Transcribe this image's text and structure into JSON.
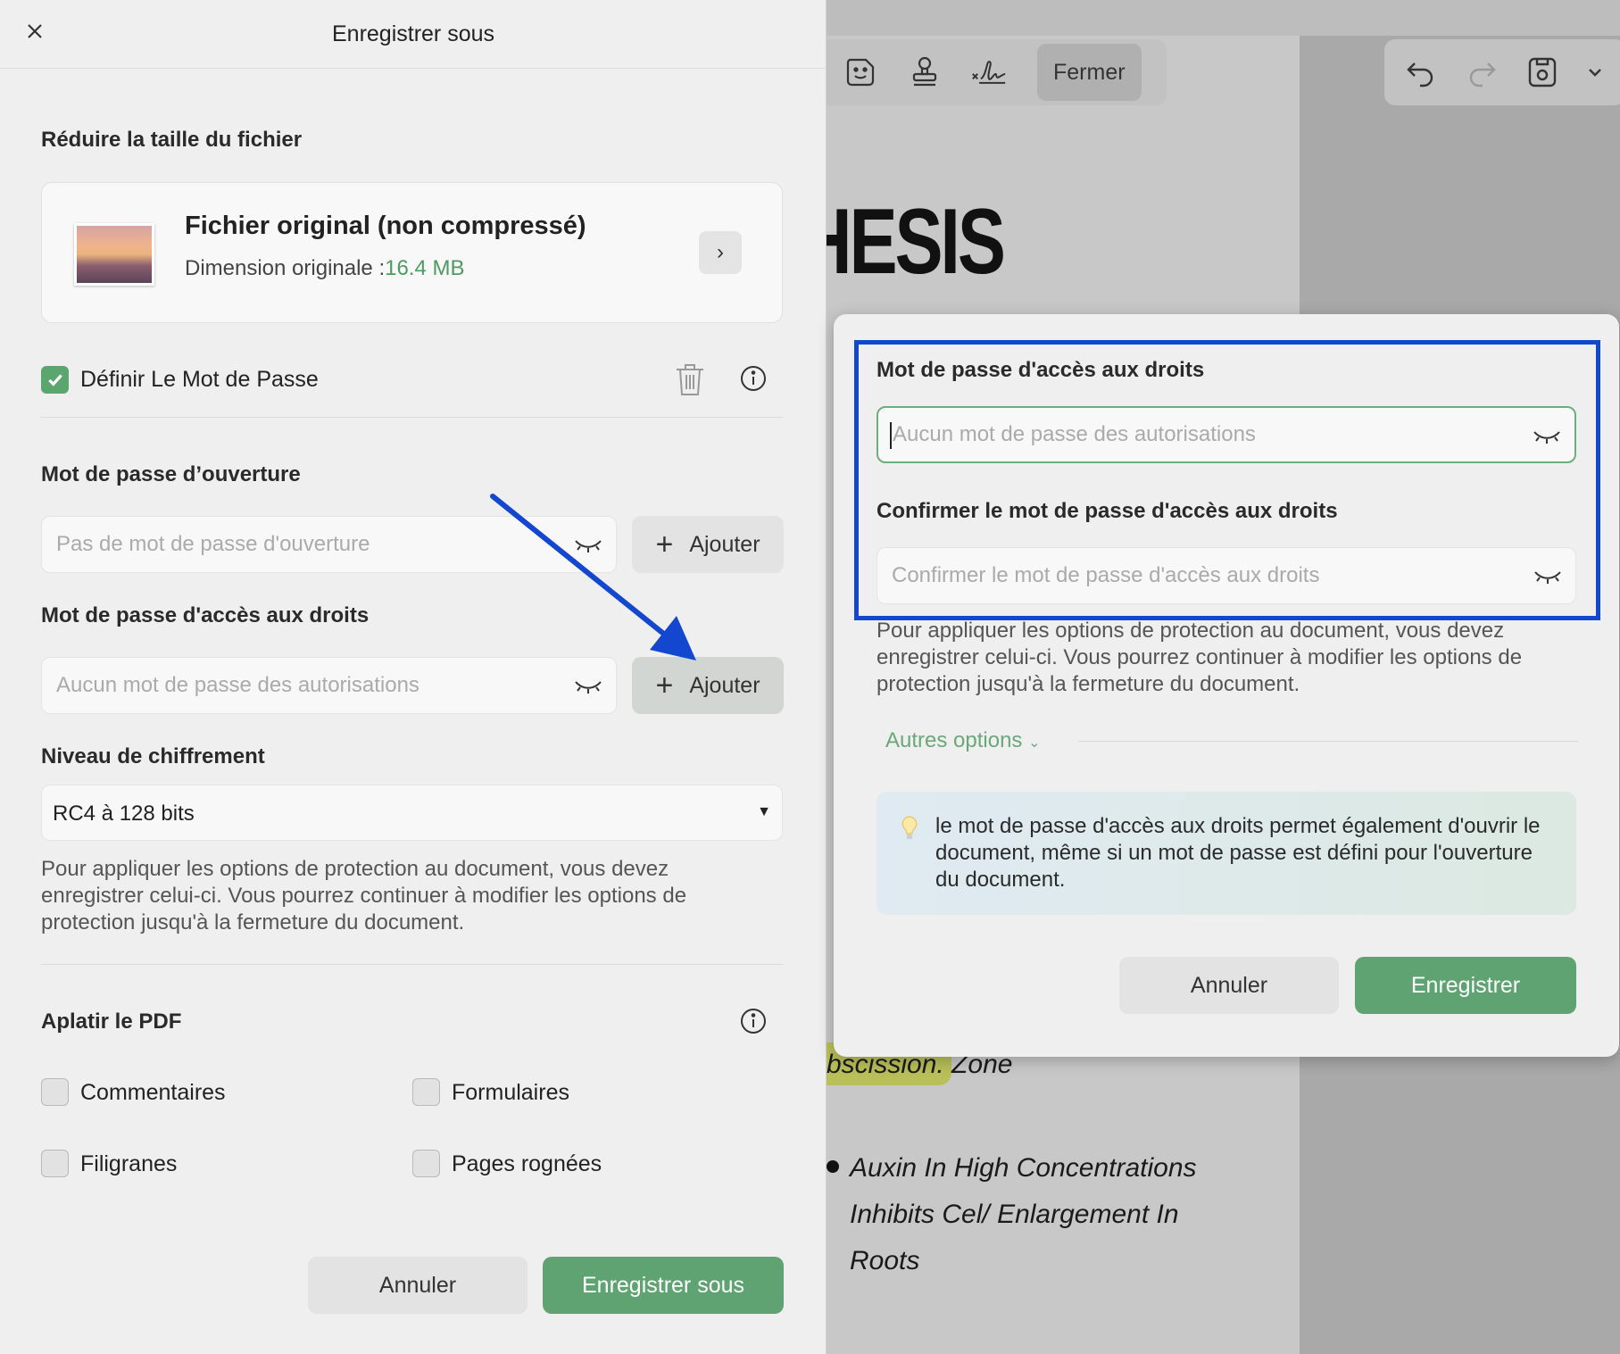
{
  "background": {
    "toolbar": {
      "close_label": "Fermer"
    },
    "document": {
      "heading": "HESIS",
      "highlight_text": "bscission. Zone",
      "lines": [
        "Auxin In High Concentrations",
        "Inhibits Cel/ Enlargement In",
        "Roots"
      ]
    }
  },
  "save_dialog": {
    "title": "Enregistrer sous",
    "reduce_section_title": "Réduire la taille du fichier",
    "file_card": {
      "name": "Fichier original (non compressé)",
      "size_label": "Dimension originale :",
      "size_value": "16.4 MB"
    },
    "set_password": {
      "label": "Définir Le Mot de Passe",
      "checked": true
    },
    "open_password": {
      "title": "Mot de passe d’ouverture",
      "placeholder": "Pas de mot de passe d'ouverture",
      "add_label": "Ajouter"
    },
    "permissions_password": {
      "title": "Mot de passe d'accès aux droits",
      "placeholder": "Aucun mot de passe des autorisations",
      "add_label": "Ajouter"
    },
    "encryption": {
      "title": "Niveau de chiffrement",
      "value": "RC4 à 128 bits"
    },
    "note": "Pour appliquer les options de protection au document, vous devez enregistrer celui-ci. Vous pourrez continuer à modifier les options de protection jusqu'à la fermeture du document.",
    "flatten": {
      "title": "Aplatir le PDF",
      "options": [
        {
          "label": "Commentaires",
          "checked": false
        },
        {
          "label": "Formulaires",
          "checked": false
        },
        {
          "label": "Filigranes",
          "checked": false
        },
        {
          "label": "Pages rognées",
          "checked": false
        }
      ]
    },
    "cancel_label": "Annuler",
    "save_label": "Enregistrer sous"
  },
  "permissions_dialog": {
    "title": "Mot de passe d'accès aux droits",
    "placeholder": "Aucun mot de passe des autorisations",
    "confirm_title": "Confirmer le mot de passe d'accès aux droits",
    "confirm_placeholder": "Confirmer le mot de passe d'accès aux droits",
    "note": "Pour appliquer les options de protection au document, vous devez enregistrer celui-ci. Vous pourrez continuer à modifier les options de protection jusqu'à la fermeture du document.",
    "more_options_label": "Autres options",
    "tip": "le mot de passe d'accès aux droits permet également d'ouvrir le document, même si un mot de passe est défini pour l'ouverture du document.",
    "cancel_label": "Annuler",
    "save_label": "Enregistrer"
  },
  "colors": {
    "accent_green": "#5ea371",
    "annotation_blue": "#1447d0"
  },
  "icons": {
    "toolbar": [
      "sticker-icon",
      "stamp-icon",
      "signature-icon",
      "undo-icon",
      "redo-icon",
      "save-icon",
      "chevron-down-icon"
    ],
    "dialog": [
      "close-icon",
      "chevron-right-icon",
      "trash-icon",
      "info-icon",
      "eye-closed-icon",
      "plus-icon",
      "lightbulb-icon"
    ]
  }
}
